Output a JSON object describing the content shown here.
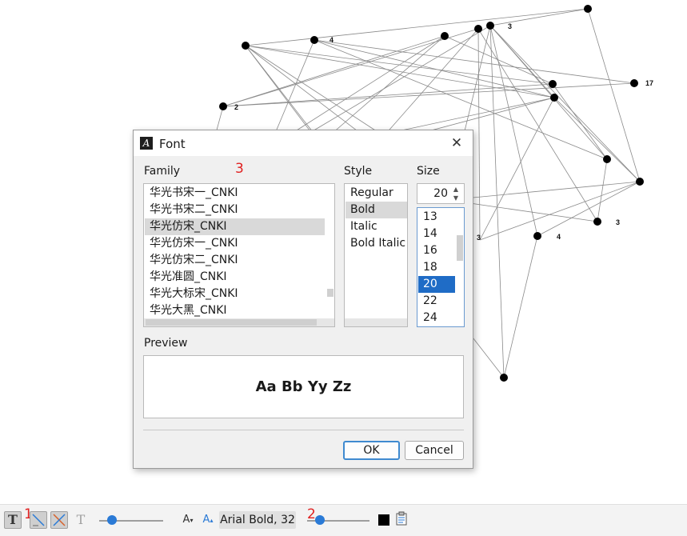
{
  "dialog": {
    "title": "Font",
    "icon": "font-icon",
    "close_label": "✕",
    "family_label": "Family",
    "style_label": "Style",
    "size_label": "Size",
    "preview_label": "Preview",
    "preview_text": "Aa Bb Yy Zz",
    "ok_label": "OK",
    "cancel_label": "Cancel",
    "families": [
      "华光书宋一_CNKI",
      "华光书宋二_CNKI",
      "华光仿宋_CNKI",
      "华光仿宋一_CNKI",
      "华光仿宋二_CNKI",
      "华光准圆_CNKI",
      "华光大标宋_CNKI",
      "华光大黑_CNKI"
    ],
    "selected_family": "华光仿宋_CNKI",
    "styles": [
      "Regular",
      "Bold",
      "Italic",
      "Bold Italic"
    ],
    "selected_style": "Bold",
    "size_value": "20",
    "sizes": [
      "13",
      "14",
      "16",
      "18",
      "20",
      "22",
      "24"
    ],
    "selected_size": "20"
  },
  "annotations": [
    "1",
    "2",
    "3"
  ],
  "toolbar": {
    "font_display": "Arial Bold, 32",
    "shrink_font_label": "A",
    "grow_font_label": "A",
    "text_tool_label": "T",
    "text_disabled_label": "T",
    "slider1_level": 0.2,
    "slider2_level": 0.2,
    "text_color": "#000000"
  },
  "graph": {
    "node_labels": [
      "4",
      "3",
      "2",
      "17",
      "3",
      "3",
      "4"
    ]
  }
}
